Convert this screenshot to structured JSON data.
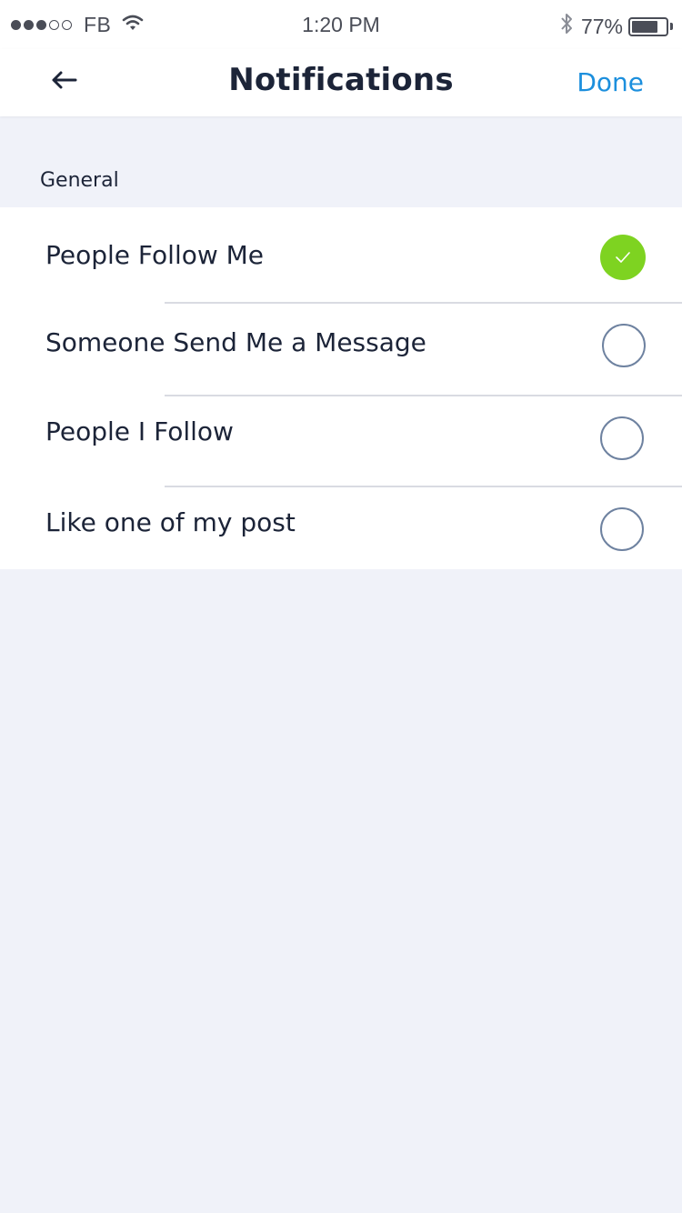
{
  "status_bar": {
    "signal_filled": 3,
    "signal_total": 5,
    "carrier": "FB",
    "time": "1:20 PM",
    "battery_percent": "77%",
    "battery_level": 0.77,
    "icons": [
      "wifi-icon",
      "bluetooth-icon",
      "battery-icon"
    ]
  },
  "nav": {
    "title": "Notifications",
    "done_label": "Done",
    "back_icon": "arrow-left-icon"
  },
  "section": {
    "title": "General"
  },
  "options": [
    {
      "label": "People Follow Me",
      "checked": true
    },
    {
      "label": "Someone Send Me a Message",
      "checked": false
    },
    {
      "label": "People I Follow",
      "checked": false
    },
    {
      "label": "Like one of my post",
      "checked": false
    }
  ],
  "colors": {
    "accent": "#1c8fdd",
    "checked": "#7ed321",
    "background": "#f0f2f9",
    "unchecked_border": "#6e82a0"
  }
}
